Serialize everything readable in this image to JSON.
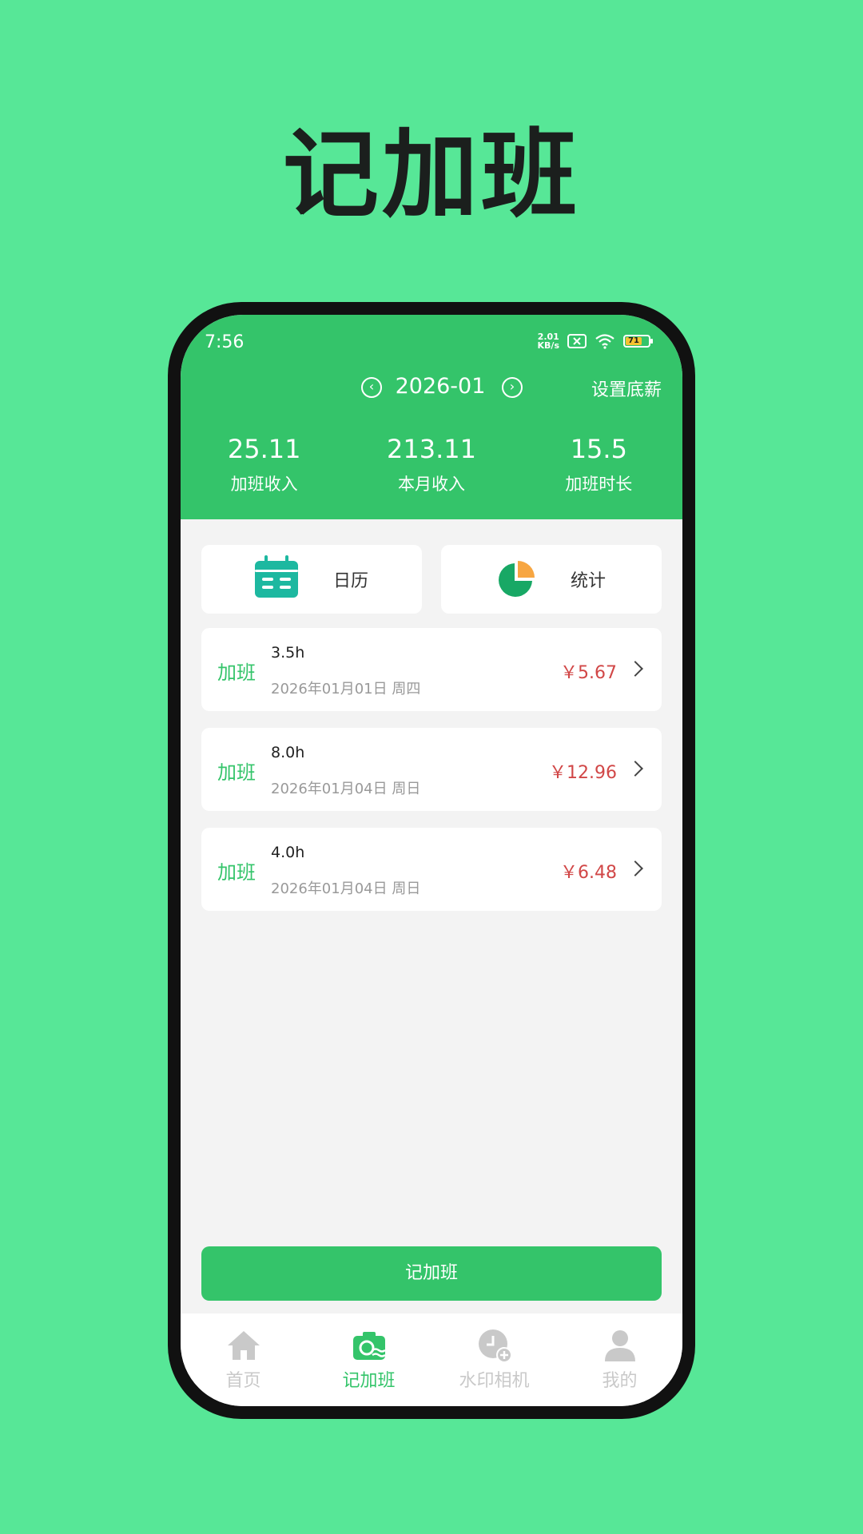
{
  "promo": {
    "headline": "记加班"
  },
  "status_bar": {
    "time": "7:56",
    "net_speed_value": "2.01",
    "net_speed_unit": "KB/s",
    "battery": "71"
  },
  "header": {
    "month": "2026-01",
    "set_salary": "设置底薪",
    "stats": [
      {
        "value": "25.11",
        "label": "加班收入"
      },
      {
        "value": "213.11",
        "label": "本月收入"
      },
      {
        "value": "15.5",
        "label": "加班时长"
      }
    ]
  },
  "quick_actions": {
    "calendar": "日历",
    "statistics": "统计"
  },
  "records": [
    {
      "type": "加班",
      "hours": "3.5h",
      "date": "2026年01月01日  周四",
      "amount": "￥5.67"
    },
    {
      "type": "加班",
      "hours": "8.0h",
      "date": "2026年01月04日  周日",
      "amount": "￥12.96"
    },
    {
      "type": "加班",
      "hours": "4.0h",
      "date": "2026年01月04日  周日",
      "amount": "￥6.48"
    }
  ],
  "add_button": "记加班",
  "tabs": [
    {
      "label": "首页",
      "icon": "home-icon",
      "active": false
    },
    {
      "label": "记加班",
      "icon": "camera-icon",
      "active": true
    },
    {
      "label": "水印相机",
      "icon": "clock-add-icon",
      "active": false
    },
    {
      "label": "我的",
      "icon": "user-icon",
      "active": false
    }
  ],
  "colors": {
    "background": "#57E797",
    "primary": "#34C46A",
    "amount": "#D14747",
    "tab_inactive": "#C9C9C9"
  }
}
